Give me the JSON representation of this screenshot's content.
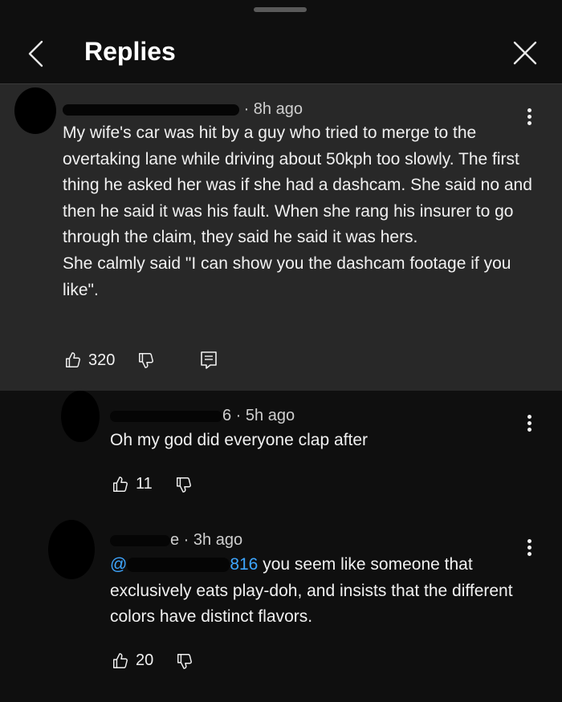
{
  "header": {
    "title": "Replies"
  },
  "main_comment": {
    "time": "8h ago",
    "body": "My wife's car was hit by a guy who tried to merge to the overtaking lane while driving about 50kph too slowly. The first thing he asked her was if she had a dashcam. She said no and then he said it was his fault. When she rang his insurer to go through the claim, they said he said it was hers.\nShe calmly said \"I can show you the dashcam footage if you like\".",
    "likes": "320"
  },
  "replies": [
    {
      "handle_tail": "6",
      "time": "5h ago",
      "body": "Oh my god did everyone clap after",
      "likes": "11"
    },
    {
      "handle_tail": "e",
      "time": "3h ago",
      "mention_prefix": "@",
      "mention_tail": "816",
      "body": " you seem like someone that exclusively eats play-doh, and insists that the different colors have distinct flavors.",
      "likes": "20"
    }
  ]
}
